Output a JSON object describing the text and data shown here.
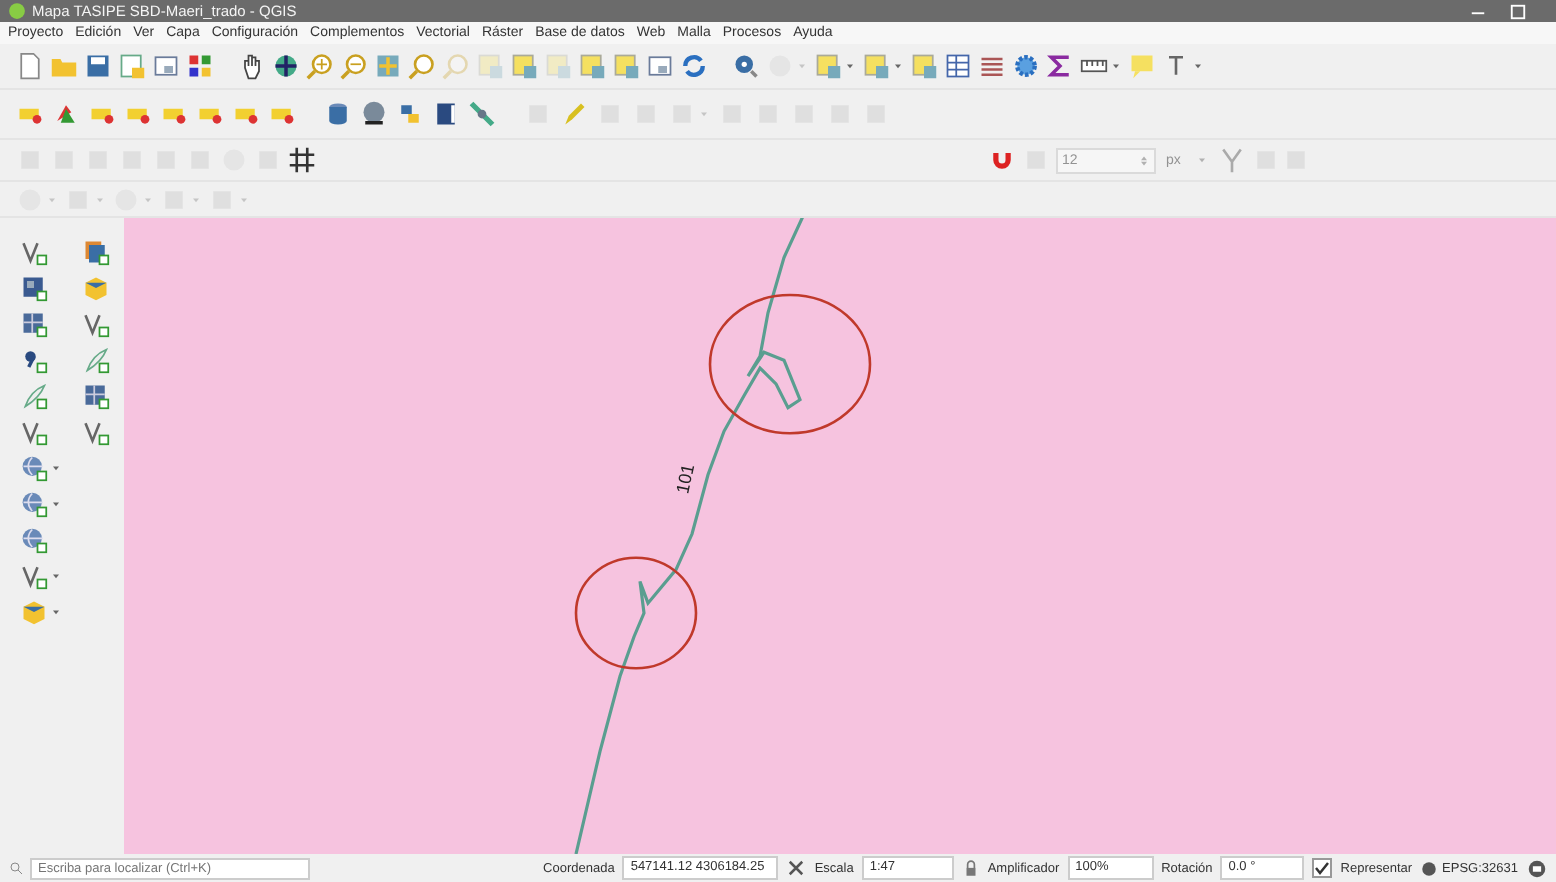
{
  "window": {
    "title": "Mapa TASIPE SBD-Maeri_trado - QGIS"
  },
  "menu": [
    "Proyecto",
    "Edición",
    "Ver",
    "Capa",
    "Configuración",
    "Complementos",
    "Vectorial",
    "Ráster",
    "Base de datos",
    "Web",
    "Malla",
    "Procesos",
    "Ayuda"
  ],
  "snapping": {
    "tolerance": "12",
    "unit": "px"
  },
  "map": {
    "label": "101"
  },
  "status_bar": {
    "search_placeholder": "Escriba para localizar (Ctrl+K)",
    "coordinate_label": "Coordenada",
    "coordinate": "547141.12 4306184.25",
    "scale_label": "Escala",
    "scale": "1:47",
    "magnifier_label": "Amplificador",
    "magnifier": "100%",
    "rotation_label": "Rotación",
    "rotation": "0.0 °",
    "render": {
      "label": "Representar",
      "checked": true
    },
    "crs": "EPSG:32631"
  }
}
